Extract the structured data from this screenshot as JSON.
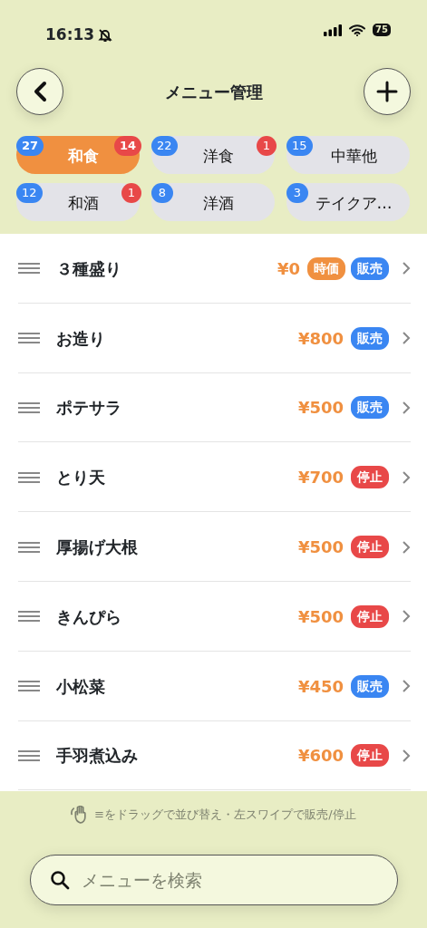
{
  "status_bar": {
    "time": "16:13",
    "silent": true,
    "battery": "75"
  },
  "header": {
    "title": "メニュー管理"
  },
  "categories": [
    {
      "label": "和食",
      "count": "27",
      "alert": "14",
      "selected": true
    },
    {
      "label": "洋食",
      "count": "22",
      "alert": "1",
      "selected": false
    },
    {
      "label": "中華他",
      "count": "15",
      "selected": false
    },
    {
      "label": "和酒",
      "count": "12",
      "alert": "1",
      "selected": false
    },
    {
      "label": "洋酒",
      "count": "8",
      "selected": false
    },
    {
      "label": "テイクア…",
      "count": "3",
      "selected": false
    }
  ],
  "items": [
    {
      "name": "３種盛り",
      "price": "¥0",
      "tag": "時価",
      "status": {
        "kind": "on",
        "label": "販売"
      }
    },
    {
      "name": "お造り",
      "price": "¥800",
      "status": {
        "kind": "on",
        "label": "販売"
      }
    },
    {
      "name": "ポテサラ",
      "price": "¥500",
      "status": {
        "kind": "on",
        "label": "販売"
      }
    },
    {
      "name": "とり天",
      "price": "¥700",
      "status": {
        "kind": "off",
        "label": "停止"
      }
    },
    {
      "name": "厚揚げ大根",
      "price": "¥500",
      "status": {
        "kind": "off",
        "label": "停止"
      }
    },
    {
      "name": "きんぴら",
      "price": "¥500",
      "status": {
        "kind": "off",
        "label": "停止"
      }
    },
    {
      "name": "小松菜",
      "price": "¥450",
      "status": {
        "kind": "on",
        "label": "販売"
      }
    },
    {
      "name": "手羽煮込み",
      "price": "¥600",
      "status": {
        "kind": "off",
        "label": "停止"
      }
    }
  ],
  "hint": "≡をドラッグで並び替え・左スワイプで販売/停止",
  "search": {
    "placeholder": "メニューを検索"
  }
}
